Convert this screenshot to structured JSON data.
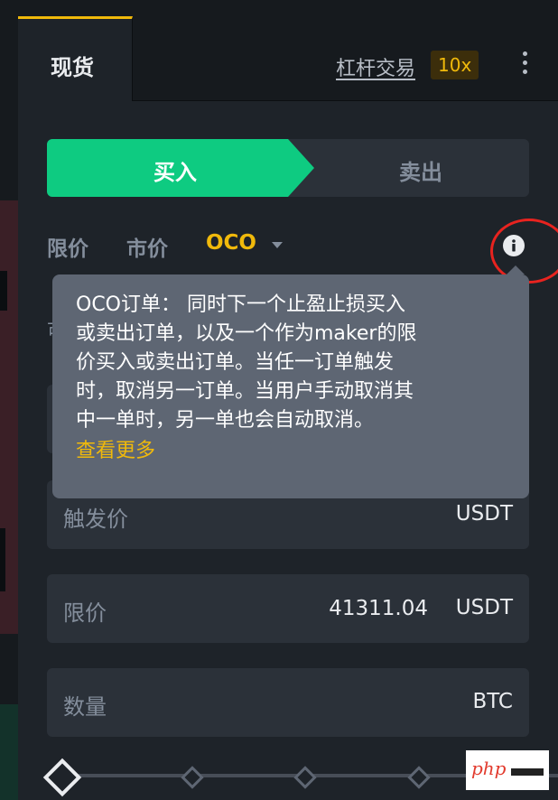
{
  "tabs": {
    "spot": "现货",
    "margin": "杠杆交易",
    "leverage": "10x"
  },
  "side": {
    "buy": "买入",
    "sell": "卖出"
  },
  "order_types": [
    "限价",
    "市价",
    "OCO"
  ],
  "hidden_label": "可",
  "tooltip": {
    "lines": [
      "OCO订单： 同时下一个止盈止损买入",
      "或卖出订单，以及一个作为maker的限",
      "价买入或卖出订单。当任一订单触发",
      "时，取消另一订单。当用户手动取消其",
      "中一单时，另一单也会自动取消。"
    ],
    "link": "查看更多"
  },
  "fields": {
    "trigger": {
      "label": "触发价",
      "unit": "USDT"
    },
    "limit": {
      "label": "限价",
      "value": "41311.04",
      "unit": "USDT"
    },
    "amount": {
      "label": "数量",
      "unit": "BTC"
    }
  },
  "watermark": "php",
  "icons": [
    "more-vertical-icon",
    "info-icon",
    "caret-down-icon",
    "slider-knob-icon"
  ],
  "colors": {
    "accent": "#f0b90b",
    "buy": "#0ecb81",
    "panel": "#1e2329",
    "input": "#2b3139",
    "tooltip": "#5e6673",
    "highlight": "#e8231f"
  }
}
